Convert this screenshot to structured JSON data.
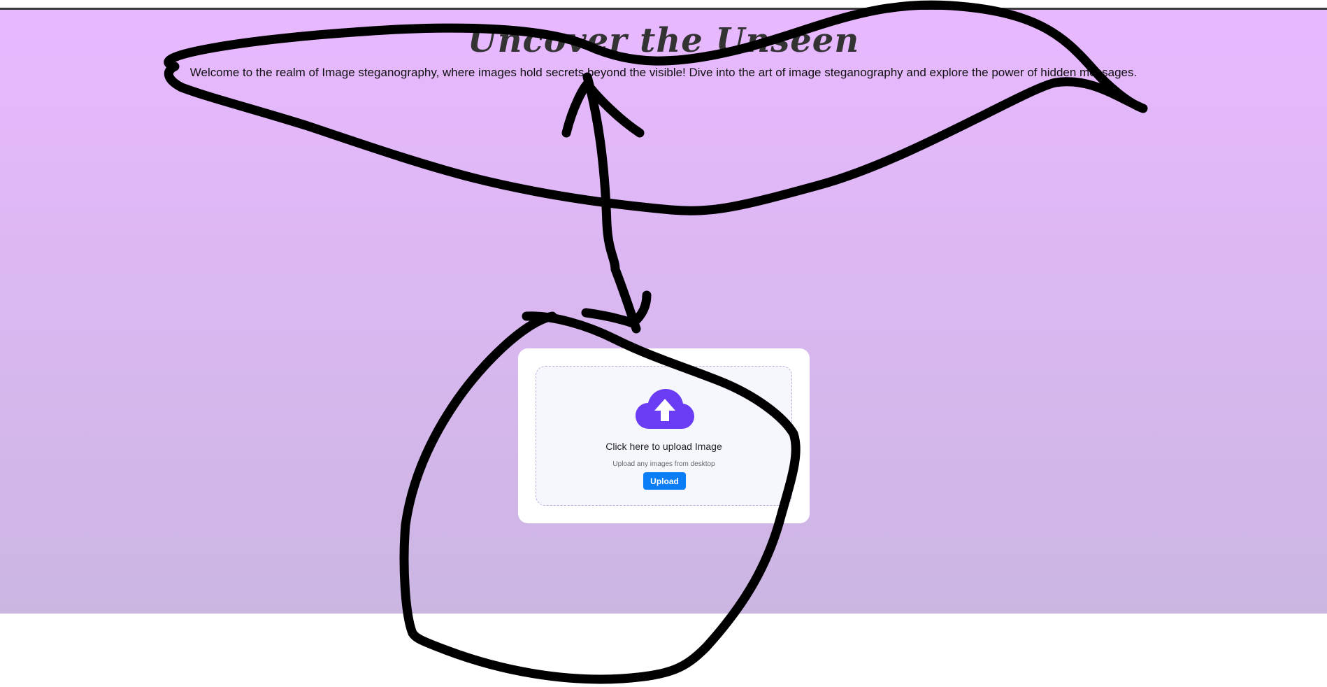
{
  "header": {
    "title": "Uncover the Unseen",
    "intro": "Welcome to the realm of Image steganography, where images hold secrets beyond the visible! Dive into the art of image steganography and explore the power of hidden messages."
  },
  "upload": {
    "icon": "cloud-upload-icon",
    "title": "Click here to upload Image",
    "subtitle": "Upload any images from desktop",
    "button_label": "Upload"
  },
  "colors": {
    "gradient_top": "#e8b8ff",
    "gradient_bottom": "#cbb6e2",
    "icon_purple": "#6a3cf4",
    "button_blue": "#0a7df7",
    "scribble": "#000000"
  }
}
